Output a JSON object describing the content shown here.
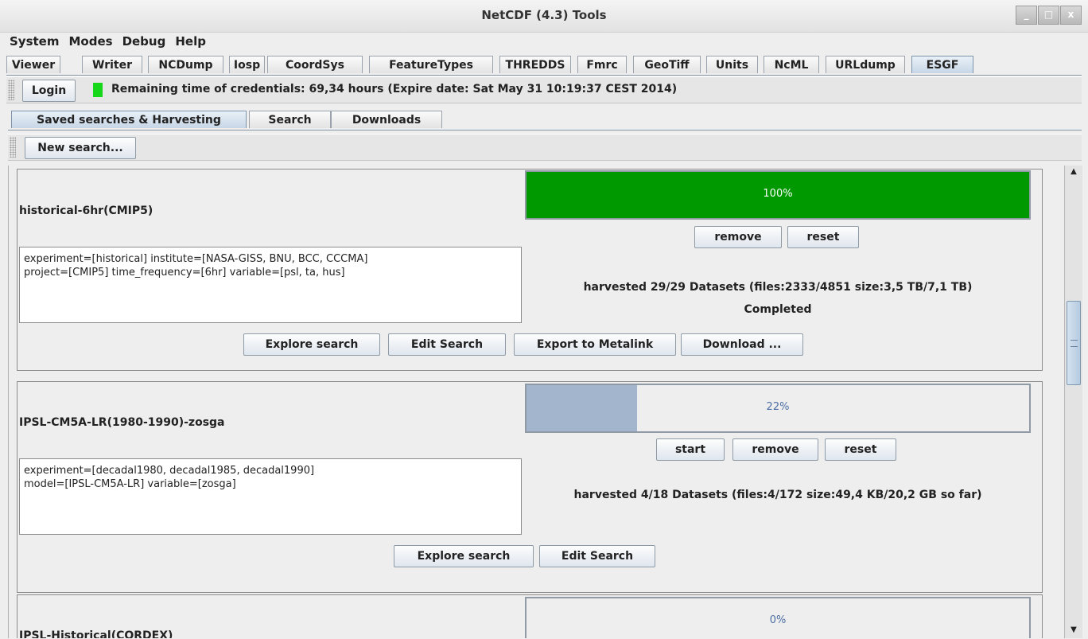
{
  "window": {
    "title": "NetCDF (4.3) Tools",
    "minimize_glyph": "_",
    "maximize_glyph": "□",
    "close_glyph": "x"
  },
  "menubar": [
    "System",
    "Modes",
    "Debug",
    "Help"
  ],
  "tabs": [
    "Viewer",
    "Writer",
    "NCDump",
    "Iosp",
    "CoordSys",
    "FeatureTypes",
    "THREDDS",
    "Fmrc",
    "GeoTiff",
    "Units",
    "NcML",
    "URLdump",
    "ESGF"
  ],
  "active_tab": "ESGF",
  "credentials": {
    "login_label": "Login",
    "status_color": "#16d71a",
    "text": "Remaining time of credentials: 69,34 hours (Expire date: Sat May 31 10:19:37 CEST 2014)"
  },
  "subtabs": [
    "Saved searches & Harvesting",
    "Search",
    "Downloads"
  ],
  "active_subtab": "Saved searches & Harvesting",
  "toolbar": {
    "new_search_label": "New search..."
  },
  "searches": [
    {
      "title": "historical-6hr(CMIP5)",
      "params": "experiment=[historical] institute=[NASA-GISS, BNU, BCC, CCCMA]\nproject=[CMIP5] time_frequency=[6hr] variable=[psl, ta, hus]",
      "progress_percent": 100,
      "progress_label": "100%",
      "progress_color": "#009900",
      "controls": [
        "remove",
        "reset"
      ],
      "harvest_info": "harvested 29/29 Datasets (files:2333/4851 size:3,5 TB/7,1 TB)",
      "status": "Completed",
      "actions": [
        "Explore search",
        "Edit Search",
        "Export to Metalink",
        "Download ..."
      ]
    },
    {
      "title": "IPSL-CM5A-LR(1980-1990)-zosga",
      "params": "experiment=[decadal1980, decadal1985, decadal1990]\nmodel=[IPSL-CM5A-LR] variable=[zosga]",
      "progress_percent": 22,
      "progress_label": "22%",
      "progress_color": "#a3b5cc",
      "controls": [
        "start",
        "remove",
        "reset"
      ],
      "harvest_info": "harvested 4/18 Datasets (files:4/172 size:49,4 KB/20,2 GB so far)",
      "actions": [
        "Explore search",
        "Edit Search"
      ]
    },
    {
      "title": "IPSL-Historical(CORDEX)",
      "progress_percent": 0,
      "progress_label": "0%"
    }
  ],
  "icons": {
    "scroll_up": "scroll-up-arrow-icon",
    "scroll_down": "scroll-down-arrow-icon"
  }
}
